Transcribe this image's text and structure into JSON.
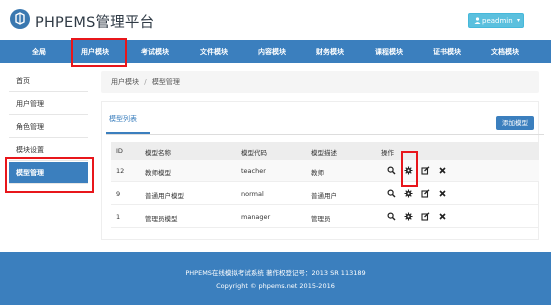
{
  "header": {
    "brand": "PHPEMS管理平台",
    "user": "peadmin"
  },
  "nav": {
    "items": [
      "全局",
      "用户模块",
      "考试模块",
      "文件模块",
      "内容模块",
      "财务模块",
      "课程模块",
      "证书模块",
      "文档模块"
    ],
    "active_index": 1
  },
  "sidebar": {
    "items": [
      "首页",
      "用户管理",
      "角色管理",
      "模块设置",
      "模型管理"
    ],
    "active_index": 4
  },
  "breadcrumb": {
    "items": [
      "用户模块",
      "模型管理"
    ],
    "separator": "/"
  },
  "panel": {
    "tab": "模型列表",
    "add_button": "添加模型"
  },
  "table": {
    "headers": [
      "ID",
      "模型名称",
      "模型代码",
      "模型描述",
      "操作"
    ],
    "rows": [
      {
        "id": "12",
        "name": "教师模型",
        "code": "teacher",
        "desc": "教师"
      },
      {
        "id": "9",
        "name": "普通用户模型",
        "code": "normal",
        "desc": "普通用户"
      },
      {
        "id": "1",
        "name": "管理员模型",
        "code": "manager",
        "desc": "管理员"
      }
    ],
    "actions": [
      "search-icon",
      "gear-icon",
      "edit-icon",
      "delete-icon"
    ]
  },
  "footer": {
    "line1": "PHPEMS在线模拟考试系统 著作权登记号：2013 SR 113189",
    "line2": "Copyright © phpems.net 2015-2016"
  },
  "colors": {
    "primary": "#3b7fbe",
    "highlight": "#e8161b",
    "user_button": "#5bc0de"
  }
}
